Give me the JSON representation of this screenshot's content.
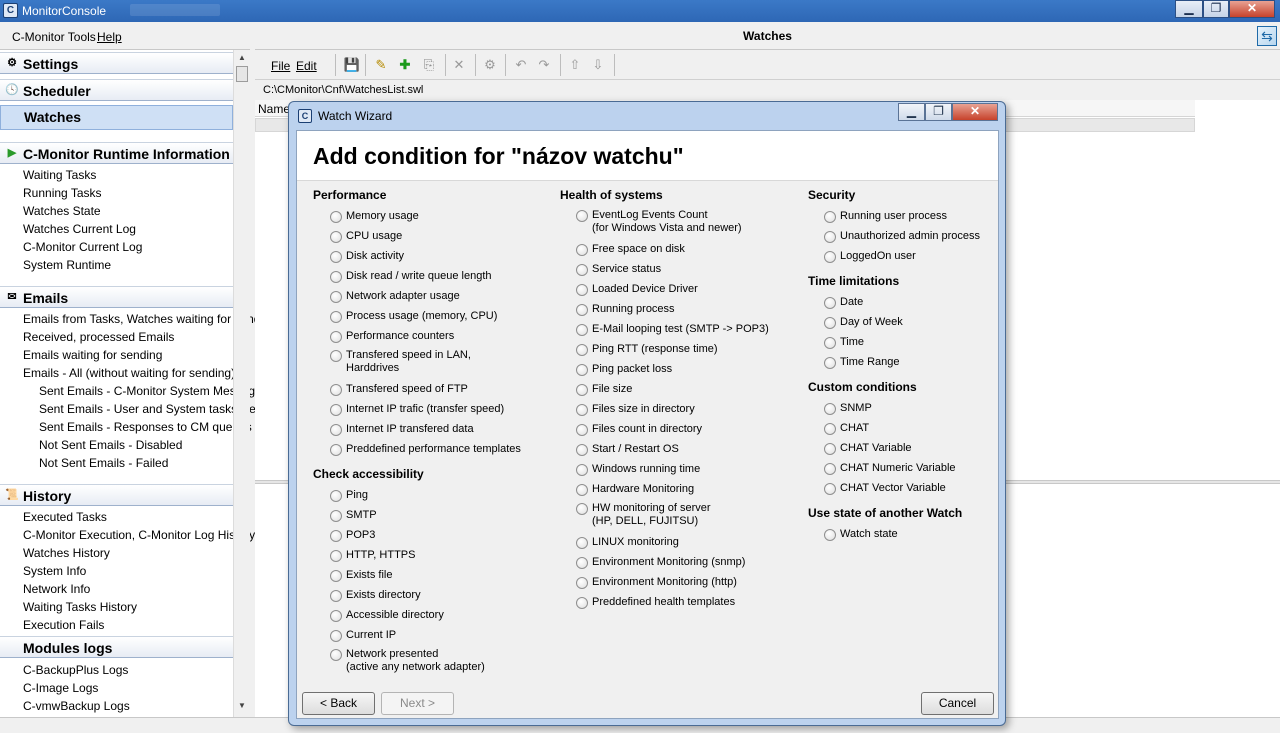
{
  "window": {
    "title": "MonitorConsole",
    "icon_letter": "C",
    "minimize_glyph": "▁",
    "restore_glyph": "❐",
    "close_glyph": "✕"
  },
  "left_menu": [
    "C-Monitor Tools",
    "Help"
  ],
  "nav": {
    "settings": "Settings",
    "scheduler": "Scheduler",
    "watches": "Watches",
    "runtime": "C-Monitor Runtime Information",
    "runtime_items": [
      "Waiting Tasks",
      "Running Tasks",
      "Watches State",
      "Watches Current Log",
      "C-Monitor Current Log",
      "System Runtime"
    ],
    "emails": "Emails",
    "email_items": [
      "Emails from Tasks, Watches waiting for send",
      "Received, processed Emails",
      "Emails waiting for sending",
      "Emails - All (without waiting for sending)"
    ],
    "email_subitems": [
      "Sent Emails - C-Monitor System Message",
      "Sent Emails - User and System tasks Res",
      "Sent Emails - Responses to CM queries",
      "Not Sent Emails - Disabled",
      "Not Sent Emails - Failed"
    ],
    "history": "History",
    "history_items": [
      "Executed Tasks",
      "C-Monitor Execution, C-Monitor Log History",
      "Watches History",
      "System Info",
      "Network Info",
      "Waiting Tasks History",
      "Execution Fails"
    ],
    "modules": "Modules logs",
    "module_items": [
      "C-BackupPlus Logs",
      "C-Image Logs",
      "C-vmwBackup Logs"
    ]
  },
  "right": {
    "title": "Watches",
    "menu": [
      "File",
      "Edit"
    ],
    "path": "C:\\CMonitor\\Cnf\\WatchesList.swl",
    "column_name": "Name"
  },
  "dialog": {
    "title": "Watch Wizard",
    "heading": "Add condition for \"názov watchu\"",
    "col1": {
      "performance_title": "Performance",
      "performance": [
        "Memory usage",
        "CPU usage",
        "Disk activity",
        "Disk read / write queue length",
        "Network adapter usage",
        "Process usage (memory, CPU)",
        "Performance counters",
        "Transfered speed in LAN,\nHarddrives",
        "Transfered speed of FTP",
        "Internet IP trafic (transfer speed)",
        "Internet IP transfered data",
        "Preddefined performance templates"
      ],
      "access_title": "Check accessibility",
      "access": [
        "Ping",
        "SMTP",
        "POP3",
        "HTTP, HTTPS",
        "Exists file",
        "Exists directory",
        "Accessible directory",
        "Current IP",
        "Network presented\n(active any network adapter)"
      ]
    },
    "col2": {
      "health_title": "Health of systems",
      "health": [
        "EventLog Events Count\n(for Windows Vista and newer)",
        "Free space on disk",
        "Service status",
        "Loaded Device Driver",
        "Running process",
        "E-Mail looping test (SMTP -> POP3)",
        "Ping RTT (response time)",
        "Ping packet loss",
        "File size",
        "Files size in directory",
        "Files count in directory",
        "Start / Restart OS",
        "Windows running time",
        "Hardware Monitoring",
        "HW monitoring of server\n(HP, DELL, FUJITSU)",
        "LINUX monitoring",
        "Environment Monitoring (snmp)",
        "Environment Monitoring (http)",
        "Preddefined health templates"
      ]
    },
    "col3": {
      "security_title": "Security",
      "security": [
        "Running user process",
        "Unauthorized admin process",
        "LoggedOn user"
      ],
      "time_title": "Time limitations",
      "time": [
        "Date",
        "Day of Week",
        "Time",
        "Time Range"
      ],
      "custom_title": "Custom conditions",
      "custom": [
        "SNMP",
        "CHAT",
        "CHAT Variable",
        "CHAT Numeric Variable",
        "CHAT Vector Variable"
      ],
      "state_title": "Use state of another Watch",
      "state": [
        "Watch state"
      ]
    },
    "buttons": {
      "back": "< Back",
      "next": "Next >",
      "cancel": "Cancel"
    }
  },
  "icons": {
    "settings": "gear-icon",
    "scheduler": "clock-icon",
    "runtime": "play-icon",
    "emails": "envelope-icon",
    "history": "scroll-icon",
    "save": "save-icon",
    "new": "new-watch-icon",
    "add": "plus-icon"
  }
}
